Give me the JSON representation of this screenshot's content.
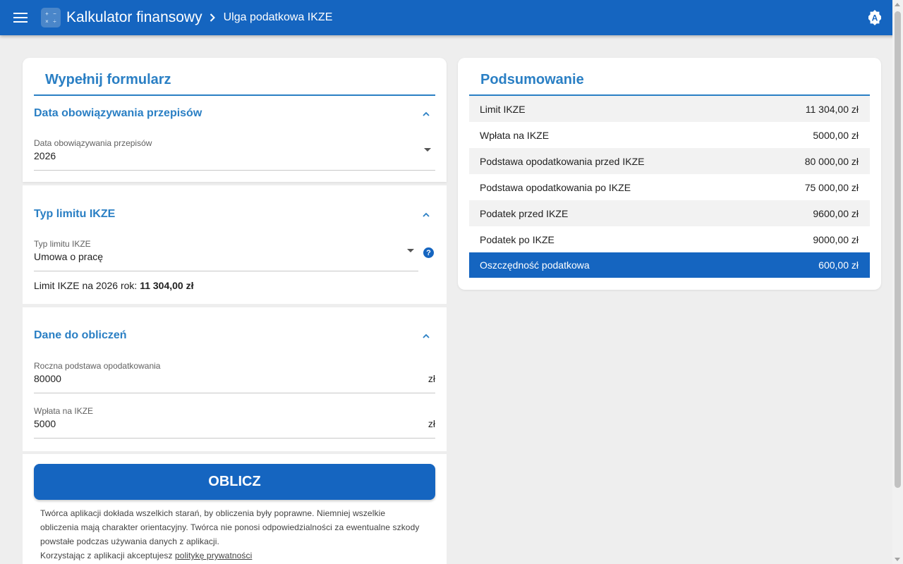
{
  "header": {
    "app_title": "Kalkulator finansowy",
    "breadcrumb": "Ulga podatkowa IKZE",
    "logo_symbols": [
      "+",
      "−",
      "×",
      "÷"
    ],
    "accessibility_letter": "A"
  },
  "form": {
    "title": "Wypełnij formularz",
    "sections": {
      "date": {
        "label": "Data obowiązywania przepisów",
        "field_label": "Data obowiązywania przepisów",
        "field_value": "2026"
      },
      "limit_type": {
        "label": "Typ limitu IKZE",
        "field_label": "Typ limitu IKZE",
        "field_value": "Umowa o pracę",
        "help_icon": "?",
        "limit_text": "Limit IKZE na 2026 rok: ",
        "limit_value": "11 304,00 zł"
      },
      "calc_data": {
        "label": "Dane do obliczeń",
        "base_label": "Roczna podstawa opodatkowania",
        "base_value": "80000",
        "base_suffix": "zł",
        "deposit_label": "Wpłata na IKZE",
        "deposit_value": "5000",
        "deposit_suffix": "zł"
      }
    },
    "calculate_button": "OBLICZ",
    "disclaimer": "Twórca aplikacji dokłada wszelkich starań, by obliczenia były poprawne. Niemniej wszelkie obliczenia mają charakter orientacyjny. Twórca nie ponosi odpowiedzialności za ewentualne szkody powstałe podczas używania danych z aplikacji.",
    "privacy_prefix": "Korzystając z aplikacji akceptujesz ",
    "privacy_link": "politykę prywatności"
  },
  "summary": {
    "title": "Podsumowanie",
    "rows": [
      {
        "label": "Limit IKZE",
        "value": "11 304,00 zł"
      },
      {
        "label": "Wpłata na IKZE",
        "value": "5000,00 zł"
      },
      {
        "label": "Podstawa opodatkowania przed IKZE",
        "value": "80 000,00 zł"
      },
      {
        "label": "Podstawa opodatkowania po IKZE",
        "value": "75 000,00 zł"
      },
      {
        "label": "Podatek przed IKZE",
        "value": "9600,00 zł"
      },
      {
        "label": "Podatek po IKZE",
        "value": "9000,00 zł"
      },
      {
        "label": "Oszczędność podatkowa",
        "value": "600,00 zł"
      }
    ]
  },
  "colors": {
    "primary": "#1565c0",
    "accent_text": "#2a7fc4",
    "background": "#eeeeee",
    "row_alt": "#f2f2f2"
  }
}
